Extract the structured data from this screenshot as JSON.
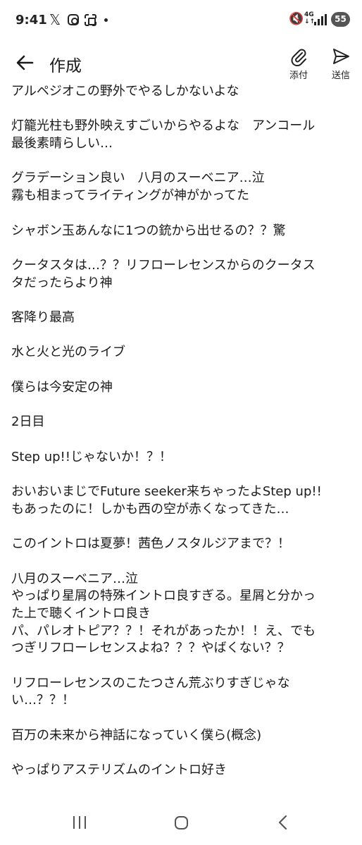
{
  "status_bar": {
    "time": "9:41",
    "icons": [
      "x-icon",
      "instagram-icon",
      "scan-icon",
      "dot-icon",
      "mute-icon",
      "network-4g-icon",
      "signal-icon"
    ],
    "network": "4G",
    "battery": "55"
  },
  "app_bar": {
    "title": "作成",
    "attach_label": "添付",
    "send_label": "送信"
  },
  "body": {
    "paragraphs": [
      [
        "アルペジオこの野外でやるしかないよな"
      ],
      [
        "灯籠光柱も野外映えすごいからやるよな　アンコール",
        "最後素晴らしい…"
      ],
      [
        "グラデーション良い　八月のスーベニア…泣",
        "霧も相まってライティングが神がかってた"
      ],
      [
        "シャボン玉あんなに1つの銃から出せるの？？驚"
      ],
      [
        "クータスタは…？？リフローレセンスからのクータス",
        "タだったらより神"
      ],
      [
        "客降り最高"
      ],
      [
        "水と火と光のライブ"
      ],
      [
        "僕らは今安定の神"
      ],
      [
        "2日目"
      ],
      [
        "Step up!!じゃないか！？！"
      ],
      [
        "おいおいまじでFuture seeker来ちゃったよStep up!!",
        "もあったのに！しかも西の空が赤くなってきた…"
      ],
      [
        "このイントロは夏夢！茜色ノスタルジアまで？！"
      ],
      [
        "八月のスーベニア…泣",
        "やっぱり星屑の特殊イントロ良すぎる。星屑と分かっ",
        "た上で聴くイントロ良き",
        "パ、パレオトピア？？！それがあったか！！え、でも",
        "つぎリフローレセンスよね？？？やばくない？？"
      ],
      [
        "リフローレセンスのこたつさん荒ぶりすぎじゃな",
        "い…？？！"
      ],
      [
        "百万の未来から神話になっていく僕ら(概念)"
      ],
      [
        "やっぱりアステリズムのイントロ好き"
      ]
    ]
  },
  "nav_bar": {
    "items": [
      "recent-apps-icon",
      "home-icon",
      "back-icon"
    ]
  }
}
